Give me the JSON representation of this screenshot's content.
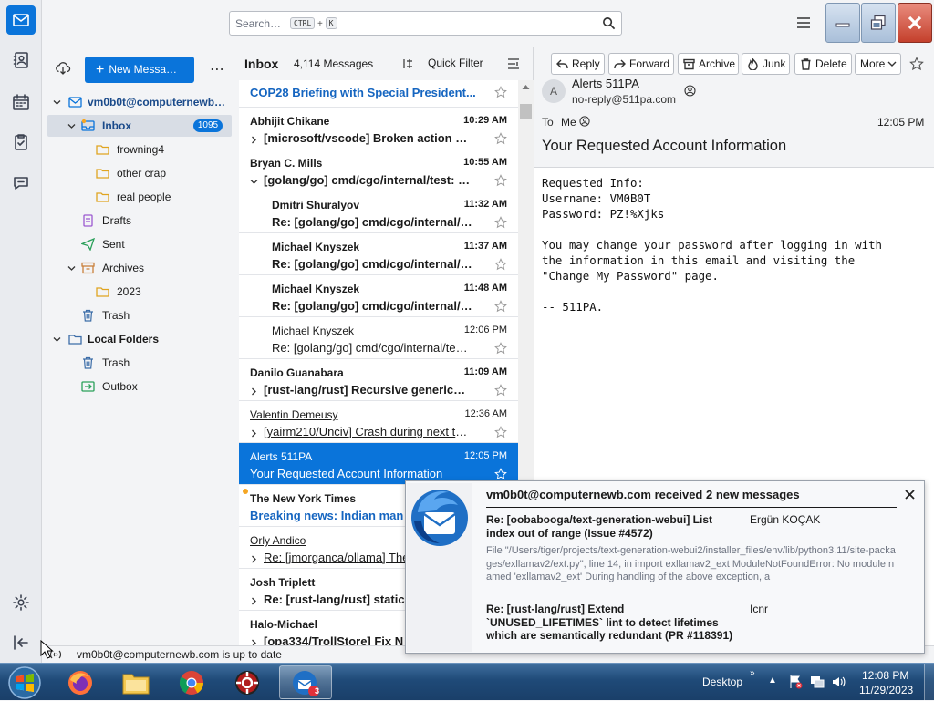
{
  "search": {
    "placeholder": "Search…",
    "key1": "CTRL",
    "plus": "+",
    "key2": "K"
  },
  "folders": {
    "new_message": "New Messa…",
    "account": "vm0b0t@computernewb.com",
    "account_short": "vm0b0t@computernewb…",
    "items": [
      {
        "label": "Inbox",
        "count": "1095"
      },
      {
        "label": "frowning4"
      },
      {
        "label": "other crap"
      },
      {
        "label": "real people"
      },
      {
        "label": "Drafts"
      },
      {
        "label": "Sent"
      },
      {
        "label": "Archives"
      },
      {
        "label": "2023"
      },
      {
        "label": "Trash"
      }
    ],
    "local_folders": "Local Folders",
    "local_items": [
      {
        "label": "Trash"
      },
      {
        "label": "Outbox"
      }
    ]
  },
  "thread": {
    "title": "Inbox",
    "count": "4,114 Messages",
    "quick_filter": "Quick Filter",
    "rows": [
      {
        "from": "",
        "time": "",
        "subject": "COP28 Briefing with Special President..."
      },
      {
        "from": "Abhijit Chikane",
        "time": "10:29 AM",
        "subject": "[microsoft/vscode] Broken action me..."
      },
      {
        "from": "Bryan C. Mills",
        "time": "10:55 AM",
        "subject": "[golang/go] cmd/cgo/internal/test: c..."
      },
      {
        "from": "Dmitri Shuralyov",
        "time": "11:32 AM",
        "subject": "Re: [golang/go] cmd/cgo/internal/t..."
      },
      {
        "from": "Michael Knyszek",
        "time": "11:37 AM",
        "subject": "Re: [golang/go] cmd/cgo/internal/t..."
      },
      {
        "from": "Michael Knyszek",
        "time": "11:48 AM",
        "subject": "Re: [golang/go] cmd/cgo/internal/t..."
      },
      {
        "from": "Michael Knyszek",
        "time": "12:06 PM",
        "subject": "Re: [golang/go] cmd/cgo/internal/test: ..."
      },
      {
        "from": "Danilo Guanabara",
        "time": "11:09 AM",
        "subject": "[rust-lang/rust] Recursive generics (I..."
      },
      {
        "from": "Valentin Demeusy",
        "time": "12:36 AM",
        "subject": "[yairm210/Unciv] Crash during next turn..."
      },
      {
        "from": "Alerts 511PA",
        "time": "12:05 PM",
        "subject": "Your Requested Account Information"
      },
      {
        "from": "The New York Times",
        "time": "",
        "subject": "Breaking news: Indian man"
      },
      {
        "from": "Orly Andico",
        "time": "",
        "subject": "Re: [jmorganca/ollama] The"
      },
      {
        "from": "Josh Triplett",
        "time": "",
        "subject": "Re: [rust-lang/rust] static"
      },
      {
        "from": "Halo-Michael",
        "time": "",
        "subject": "[opa334/TrollStore] Fix N"
      }
    ]
  },
  "message": {
    "buttons": [
      "Reply",
      "Forward",
      "Archive",
      "Junk",
      "Delete",
      "More"
    ],
    "avatar_letter": "A",
    "from_name": "Alerts 511PA",
    "from_email": "no-reply@511pa.com",
    "to_label": "To",
    "to_value": "Me",
    "time": "12:05 PM",
    "subject": "Your Requested Account Information",
    "body": "Requested Info:\nUsername: VM0B0T\nPassword: PZ!%Xjks\n\nYou may change your password after logging in with\nthe information in this email and visiting the\n\"Change My Password\" page.\n\n-- 511PA."
  },
  "notification": {
    "title": "vm0b0t@computernewb.com received 2 new messages",
    "items": [
      {
        "subject": "Re: [oobabooga/text-generation-webui] List index out of range (Issue #4572)",
        "sender": "Ergün KOÇAK",
        "preview": "File \"/Users/tiger/projects/text-generation-webui2/installer_files/env/lib/python3.11/site-packages/exllamav2/ext.py\", line 14, in import exllamav2_ext ModuleNotFoundError: No module named 'exllamav2_ext' During handling of the above exception, a"
      },
      {
        "subject": "Re: [rust-lang/rust] Extend `UNUSED_LIFETIMES` lint to detect lifetimes which are semantically redundant (PR #118391)",
        "sender": "Icnr",
        "preview": ""
      }
    ]
  },
  "status": {
    "text": "vm0b0t@computernewb.com is up to date"
  },
  "taskbar": {
    "desktop": "Desktop",
    "time": "12:08 PM",
    "date": "11/29/2023",
    "badge": "3"
  },
  "colors": {
    "accent": "#0a74da",
    "unread_blue": "#1565c0",
    "folder_yellow": "#f5c342"
  }
}
